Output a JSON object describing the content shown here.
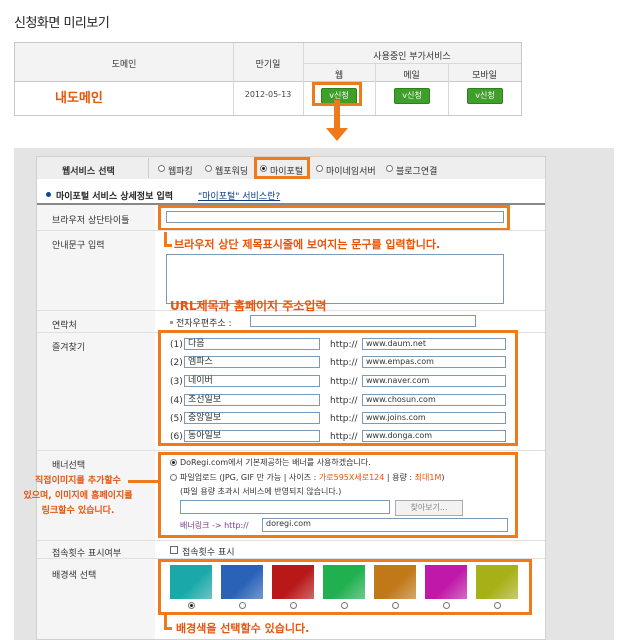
{
  "page_title": "신청화면 미리보기",
  "domain_table": {
    "col_domain": "도메인",
    "col_expire": "만기일",
    "col_services": "사용중인 부가서비스",
    "sub_cols": [
      "웹",
      "메일",
      "모바일"
    ],
    "domain_name": "내도메인",
    "expire_date": "2012-05-13",
    "apply_label": "v신청"
  },
  "web_service": {
    "label": "웹서비스 선택",
    "options": [
      "웹파킹",
      "웹포워딩",
      "마이포털",
      "마이네임서버",
      "블로그연결"
    ],
    "selected": "마이포털"
  },
  "section": {
    "title": "마이포털 서비스 상세정보 입력",
    "link": "\"마이포털\" 서비스란?"
  },
  "browser_title": {
    "label": "브라우저 상단타이틀",
    "value": ""
  },
  "guide": {
    "label": "안내문구 입력",
    "value": ""
  },
  "contact": {
    "label": "연락처",
    "email_label": "전자우편주소 :",
    "email_value": ""
  },
  "favorites": {
    "label": "즐겨찾기",
    "http_prefix": "http://",
    "items": [
      {
        "num": "(1)",
        "name": "다음",
        "url": "www.daum.net"
      },
      {
        "num": "(2)",
        "name": "엠파스",
        "url": "www.empas.com"
      },
      {
        "num": "(3)",
        "name": "네이버",
        "url": "www.naver.com"
      },
      {
        "num": "(4)",
        "name": "조선일보",
        "url": "www.chosun.com"
      },
      {
        "num": "(5)",
        "name": "중앙일보",
        "url": "www.joins.com"
      },
      {
        "num": "(6)",
        "name": "동아일보",
        "url": "www.donga.com"
      }
    ]
  },
  "banner": {
    "label": "배너선택",
    "option1": "DoRegi.com에서 기본제공하는 배너를 사용하겠습니다.",
    "option2_a": "파일업로드 (JPG, GIF 만 가능 | 사이즈 : ",
    "option2_size": "가로595X세로124",
    "option2_b": " | 용량 : ",
    "option2_cap": "최대1M",
    "option2_c": ")",
    "option2_note": "(파일 용량 초과시 서비스에 반영되지 않습니다.)",
    "browse_label": "찾아보기...",
    "link_label": "배너링크 -> http://",
    "link_value": "doregi.com"
  },
  "counter": {
    "label": "접속횟수 표시여부",
    "checkbox_label": "접속횟수 표시"
  },
  "bg_color": {
    "label": "배경색 선택",
    "colors": [
      "#1aa8a8",
      "#2a62b8",
      "#b81818",
      "#20b050",
      "#c07818",
      "#c018a8",
      "#a8b018"
    ],
    "selected_index": 0
  },
  "annotations": {
    "title_note": "브라우저 상단 제목표시줄에 보여지는 문구를 입력합니다.",
    "url_note": "URL제목과 홈페이지 주소입력",
    "banner_note": "직접이미지를 추가할수\n있으며, 이미지에 홈페이지를\n링크할수 있습니다.",
    "bg_note": "배경색을 선택할수 있습니다."
  },
  "colors": {
    "accent_orange": "#f07a1a",
    "note_orange": "#e8540c",
    "apply_green": "#3f9f2b"
  }
}
